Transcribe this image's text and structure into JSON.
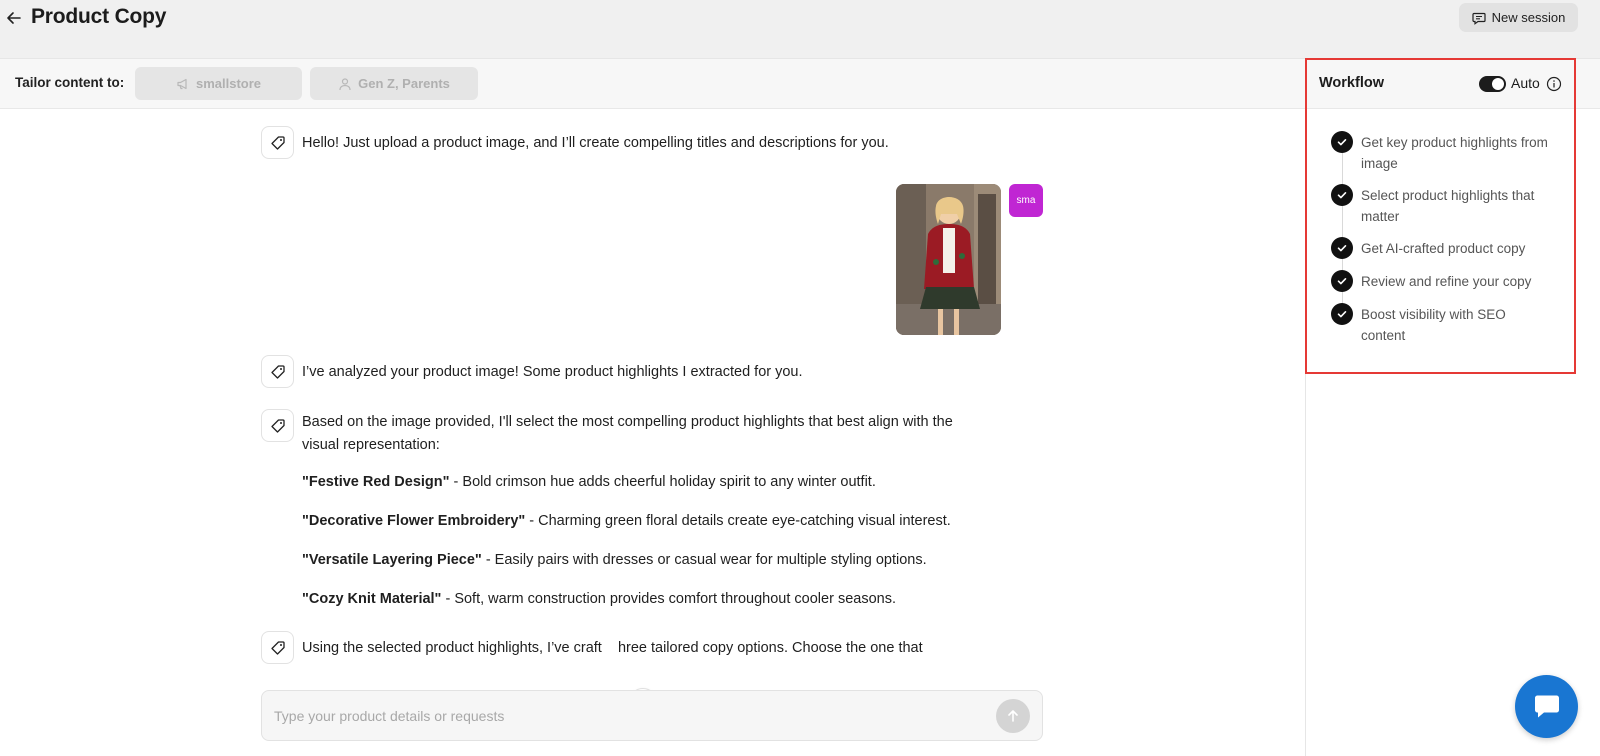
{
  "header": {
    "title": "Product Copy",
    "new_session_label": "New session"
  },
  "tailor": {
    "label": "Tailor content to:",
    "store": "smallstore",
    "audience": "Gen Z, Parents"
  },
  "chat": {
    "greeting": "Hello! Just upload a product image, and I’ll create compelling titles and descriptions for you.",
    "user_avatar_text": "sma",
    "analyzed": "I’ve analyzed your product image! Some product highlights I extracted for you.",
    "selection_intro": "Based on the image provided, I'll select the most compelling product highlights that best align with the visual representation:",
    "highlights": [
      {
        "title": "\"Festive Red Design\"",
        "desc": " - Bold crimson hue adds cheerful holiday spirit to any winter outfit."
      },
      {
        "title": "\"Decorative Flower Embroidery\"",
        "desc": " - Charming green floral details create eye-catching visual interest."
      },
      {
        "title": "\"Versatile Layering Piece\"",
        "desc": " - Easily pairs with dresses or casual wear for multiple styling options."
      },
      {
        "title": "\"Cozy Knit Material\"",
        "desc": " - Soft, warm construction provides comfort throughout cooler seasons."
      }
    ],
    "copy_options_partial": "Using the selected product highlights, I’ve craft    hree tailored copy options. Choose the one that"
  },
  "input": {
    "placeholder": "Type your product details or requests"
  },
  "workflow": {
    "title": "Workflow",
    "auto_label": "Auto",
    "auto_enabled": true,
    "steps": [
      {
        "label": "Get key product highlights from image",
        "done": true
      },
      {
        "label": "Select product highlights that matter",
        "done": true
      },
      {
        "label": "Get AI-crafted product copy",
        "done": true
      },
      {
        "label": "Review and refine your copy",
        "done": true
      },
      {
        "label": "Boost visibility with SEO content",
        "done": true
      }
    ]
  },
  "colors": {
    "accent_dark": "#111111",
    "user_avatar": "#c026d3",
    "fab": "#1976d2",
    "highlight_border": "#e53935"
  },
  "icons": {
    "back": "arrow-left-icon",
    "new_session": "chat-bubble-icon",
    "store": "megaphone-icon",
    "audience": "user-icon",
    "bot": "tag-icon",
    "scroll": "arrow-down-icon",
    "send": "arrow-up-icon",
    "info": "info-icon",
    "check": "check-icon",
    "fab": "chat-icon"
  }
}
